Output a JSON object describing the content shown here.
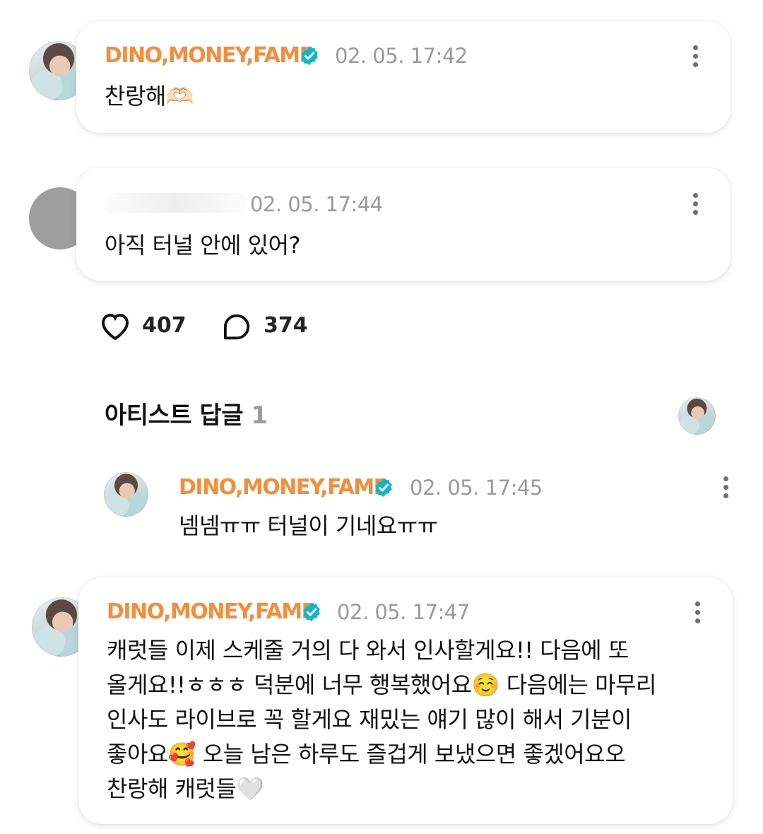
{
  "comments": [
    {
      "author": "DINO,MONEY,FAME",
      "verified": true,
      "timestamp": "02. 05. 17:42",
      "text": "찬랑해🫶🏻"
    },
    {
      "author": "",
      "verified": false,
      "timestamp": "02. 05. 17:44",
      "text": "아직 터널 안에 있어?"
    }
  ],
  "stats": {
    "likes": "407",
    "comments": "374"
  },
  "artist_replies": {
    "title": "아티스트 답글",
    "count": "1"
  },
  "reply": {
    "author": "DINO,MONEY,FAME",
    "verified": true,
    "timestamp": "02. 05. 17:45",
    "text": "넴넴ㅠㅠ 터널이 기네요ㅠㅠ"
  },
  "last_comment": {
    "author": "DINO,MONEY,FAME",
    "verified": true,
    "timestamp": "02. 05. 17:47",
    "lines": [
      "캐럿들 이제 스케줄 거의 다 와서 인사할게요!! 다음에 또",
      "올게요!!ㅎㅎㅎ 덕분에 너무 행복했어요☺️ 다음에는 마무리",
      "인사도 라이브로 꼭 할게요 재밌는 얘기 많이 해서 기분이",
      "좋아요🥰 오늘 남은 하루도 즐겁게 보냈으면 좋겠어요오",
      "찬랑해 캐럿들🤍"
    ]
  },
  "colors": {
    "author_name": "#f58d3b",
    "verified_badge": "#13b5c9",
    "timestamp": "#9a9a9a"
  },
  "icons": {
    "verified": "verified-badge-icon",
    "more": "more-vertical-icon",
    "like": "heart-icon",
    "comment": "comment-bubble-icon"
  }
}
